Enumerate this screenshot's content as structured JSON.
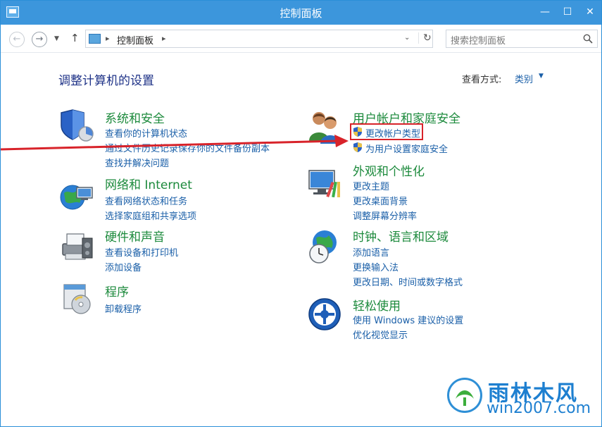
{
  "window": {
    "title": "控制面板"
  },
  "nav": {
    "breadcrumb": "控制面板",
    "search_placeholder": "搜索控制面板"
  },
  "main": {
    "heading": "调整计算机的设置",
    "view_label": "查看方式:",
    "view_value": "类别"
  },
  "categories": [
    {
      "title": "系统和安全",
      "links": [
        "查看你的计算机状态",
        "通过文件历史记录保存你的文件备份副本",
        "查找并解决问题"
      ]
    },
    {
      "title": "网络和 Internet",
      "links": [
        "查看网络状态和任务",
        "选择家庭组和共享选项"
      ]
    },
    {
      "title": "硬件和声音",
      "links": [
        "查看设备和打印机",
        "添加设备"
      ]
    },
    {
      "title": "程序",
      "links": [
        "卸载程序"
      ]
    },
    {
      "title": "用户帐户和家庭安全",
      "links": [
        "更改帐户类型",
        "为用户设置家庭安全"
      ]
    },
    {
      "title": "外观和个性化",
      "links": [
        "更改主题",
        "更改桌面背景",
        "调整屏幕分辨率"
      ]
    },
    {
      "title": "时钟、语言和区域",
      "links": [
        "添加语言",
        "更换输入法",
        "更改日期、时间或数字格式"
      ]
    },
    {
      "title": "轻松使用",
      "links": [
        "使用 Windows 建议的设置",
        "优化视觉显示"
      ]
    }
  ],
  "watermark": {
    "name": "雨林木风",
    "site": "win2007.com"
  },
  "colors": {
    "titlebar": "#3c96dc",
    "category_title": "#1c8a3c",
    "link": "#1a5fa8",
    "annotation": "#d8232a"
  }
}
